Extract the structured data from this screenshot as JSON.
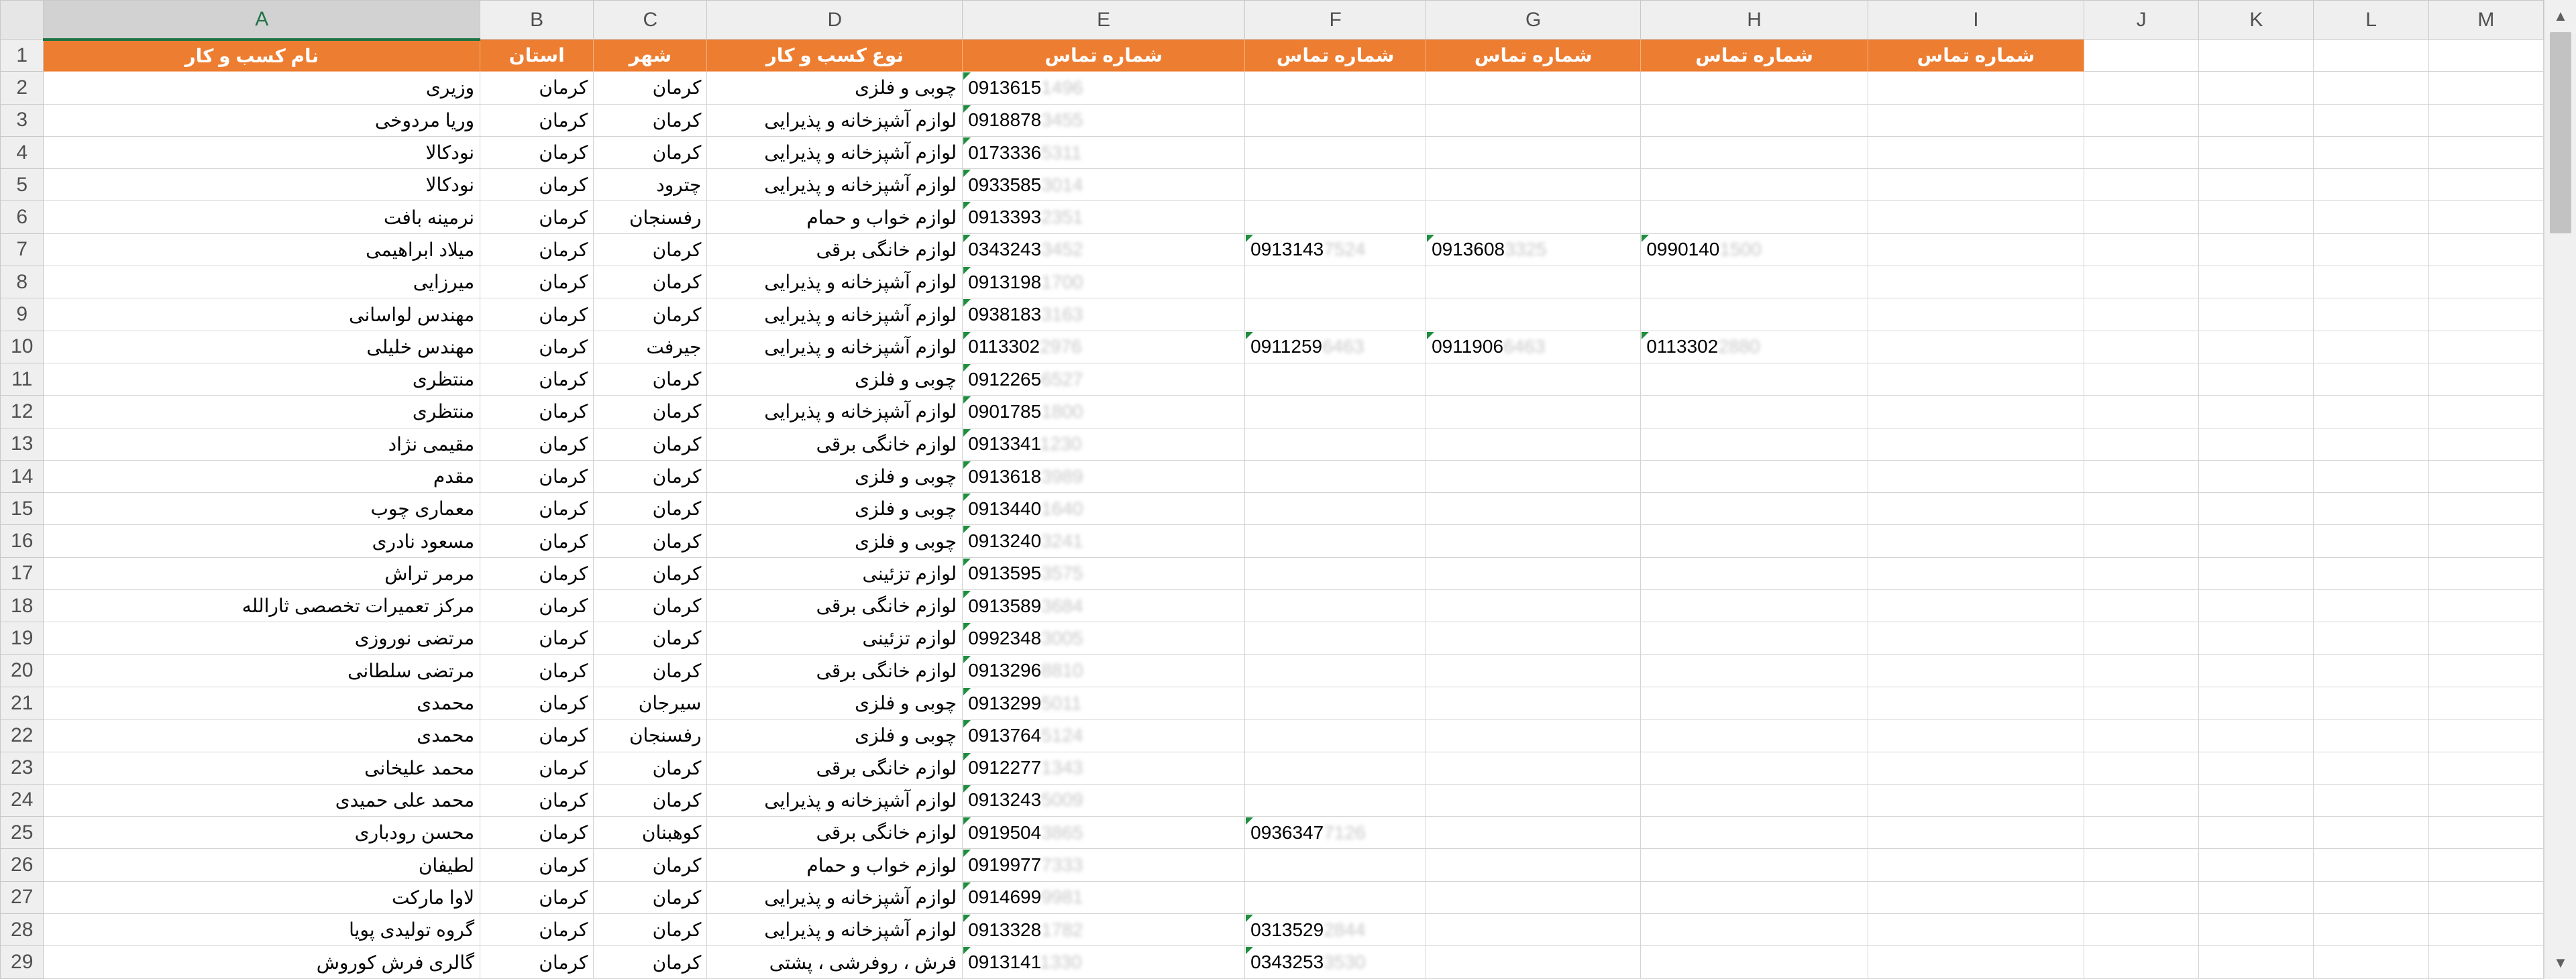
{
  "columns": [
    "A",
    "B",
    "C",
    "D",
    "E",
    "F",
    "G",
    "H",
    "I",
    "J",
    "K",
    "L",
    "M"
  ],
  "active_column": "A",
  "header_row": {
    "number": "1",
    "name": "نام کسب و کار",
    "province": "استان",
    "city": "شهر",
    "type": "نوع کسب و کار",
    "phone": "شماره تماس",
    "phone2": "شماره تماس",
    "phone3": "شماره تماس",
    "phone4": "شماره تماس",
    "phone5": "شماره تماس"
  },
  "rows": [
    {
      "n": "2",
      "name": "وزیری",
      "prov": "کرمان",
      "city": "کرمان",
      "type": "چوبی و فلزی",
      "ph": "0913615",
      "phb": "1496",
      "x1": "",
      "x1b": "",
      "x2": "",
      "x2b": "",
      "x3": "",
      "x3b": ""
    },
    {
      "n": "3",
      "name": "وریا مردوخی",
      "prov": "کرمان",
      "city": "کرمان",
      "type": "لوازم آشپزخانه و پذیرایی",
      "ph": "0918878",
      "phb": "3455",
      "x1": "",
      "x1b": "",
      "x2": "",
      "x2b": "",
      "x3": "",
      "x3b": ""
    },
    {
      "n": "4",
      "name": "نودکالا",
      "prov": "کرمان",
      "city": "کرمان",
      "type": "لوازم آشپزخانه و پذیرایی",
      "ph": "0173336",
      "phb": "5311",
      "x1": "",
      "x1b": "",
      "x2": "",
      "x2b": "",
      "x3": "",
      "x3b": ""
    },
    {
      "n": "5",
      "name": "نودکالا",
      "prov": "کرمان",
      "city": "چترود",
      "type": "لوازم آشپزخانه و پذیرایی",
      "ph": "0933585",
      "phb": "3014",
      "x1": "",
      "x1b": "",
      "x2": "",
      "x2b": "",
      "x3": "",
      "x3b": ""
    },
    {
      "n": "6",
      "name": "نرمینه بافت",
      "prov": "کرمان",
      "city": "رفسنجان",
      "type": "لوازم خواب و حمام",
      "ph": "0913393",
      "phb": "2351",
      "x1": "",
      "x1b": "",
      "x2": "",
      "x2b": "",
      "x3": "",
      "x3b": ""
    },
    {
      "n": "7",
      "name": "میلاد ابراهیمی",
      "prov": "کرمان",
      "city": "کرمان",
      "type": "لوازم خانگی برقی",
      "ph": "0343243",
      "phb": "3452",
      "x1": "0913143",
      "x1b": "7524",
      "x2": "0913608",
      "x2b": "3325",
      "x3": "0990140",
      "x3b": "1500"
    },
    {
      "n": "8",
      "name": "میرزایی",
      "prov": "کرمان",
      "city": "کرمان",
      "type": "لوازم آشپزخانه و پذیرایی",
      "ph": "0913198",
      "phb": "1700",
      "x1": "",
      "x1b": "",
      "x2": "",
      "x2b": "",
      "x3": "",
      "x3b": ""
    },
    {
      "n": "9",
      "name": "مهندس لواسانی",
      "prov": "کرمان",
      "city": "کرمان",
      "type": "لوازم آشپزخانه و پذیرایی",
      "ph": "0938183",
      "phb": "3163",
      "x1": "",
      "x1b": "",
      "x2": "",
      "x2b": "",
      "x3": "",
      "x3b": ""
    },
    {
      "n": "10",
      "name": "مهندس خلیلی",
      "prov": "کرمان",
      "city": "جیرفت",
      "type": "لوازم آشپزخانه و پذیرایی",
      "ph": "0113302",
      "phb": "2976",
      "x1": "0911259",
      "x1b": "6463",
      "x2": "0911906",
      "x2b": "6463",
      "x3": "0113302",
      "x3b": "2880"
    },
    {
      "n": "11",
      "name": "منتظری",
      "prov": "کرمان",
      "city": "کرمان",
      "type": "چوبی و فلزی",
      "ph": "0912265",
      "phb": "6527",
      "x1": "",
      "x1b": "",
      "x2": "",
      "x2b": "",
      "x3": "",
      "x3b": ""
    },
    {
      "n": "12",
      "name": "منتظری",
      "prov": "کرمان",
      "city": "کرمان",
      "type": "لوازم آشپزخانه و پذیرایی",
      "ph": "0901785",
      "phb": "1800",
      "x1": "",
      "x1b": "",
      "x2": "",
      "x2b": "",
      "x3": "",
      "x3b": ""
    },
    {
      "n": "13",
      "name": "مقیمی نژاد",
      "prov": "کرمان",
      "city": "کرمان",
      "type": "لوازم خانگی برقی",
      "ph": "0913341",
      "phb": "1230",
      "x1": "",
      "x1b": "",
      "x2": "",
      "x2b": "",
      "x3": "",
      "x3b": ""
    },
    {
      "n": "14",
      "name": "مقدم",
      "prov": "کرمان",
      "city": "کرمان",
      "type": "چوبی و فلزی",
      "ph": "0913618",
      "phb": "3989",
      "x1": "",
      "x1b": "",
      "x2": "",
      "x2b": "",
      "x3": "",
      "x3b": ""
    },
    {
      "n": "15",
      "name": "معماری چوب",
      "prov": "کرمان",
      "city": "کرمان",
      "type": "چوبی و فلزی",
      "ph": "0913440",
      "phb": "1640",
      "x1": "",
      "x1b": "",
      "x2": "",
      "x2b": "",
      "x3": "",
      "x3b": ""
    },
    {
      "n": "16",
      "name": "مسعود نادری",
      "prov": "کرمان",
      "city": "کرمان",
      "type": "چوبی و فلزی",
      "ph": "0913240",
      "phb": "3241",
      "x1": "",
      "x1b": "",
      "x2": "",
      "x2b": "",
      "x3": "",
      "x3b": ""
    },
    {
      "n": "17",
      "name": "مرمر تراش",
      "prov": "کرمان",
      "city": "کرمان",
      "type": "لوازم تزئینی",
      "ph": "0913595",
      "phb": "3575",
      "x1": "",
      "x1b": "",
      "x2": "",
      "x2b": "",
      "x3": "",
      "x3b": ""
    },
    {
      "n": "18",
      "name": "مرکز تعمیرات تخصصی ثارالله",
      "prov": "کرمان",
      "city": "کرمان",
      "type": "لوازم خانگی برقی",
      "ph": "0913589",
      "phb": "3684",
      "x1": "",
      "x1b": "",
      "x2": "",
      "x2b": "",
      "x3": "",
      "x3b": ""
    },
    {
      "n": "19",
      "name": "مرتضی نوروزی",
      "prov": "کرمان",
      "city": "کرمان",
      "type": "لوازم تزئینی",
      "ph": "0992348",
      "phb": "3005",
      "x1": "",
      "x1b": "",
      "x2": "",
      "x2b": "",
      "x3": "",
      "x3b": ""
    },
    {
      "n": "20",
      "name": "مرتضی سلطانی",
      "prov": "کرمان",
      "city": "کرمان",
      "type": "لوازم خانگی برقی",
      "ph": "0913296",
      "phb": "8810",
      "x1": "",
      "x1b": "",
      "x2": "",
      "x2b": "",
      "x3": "",
      "x3b": ""
    },
    {
      "n": "21",
      "name": "محمدی",
      "prov": "کرمان",
      "city": "سیرجان",
      "type": "چوبی و فلزی",
      "ph": "0913299",
      "phb": "5011",
      "x1": "",
      "x1b": "",
      "x2": "",
      "x2b": "",
      "x3": "",
      "x3b": ""
    },
    {
      "n": "22",
      "name": "محمدی",
      "prov": "کرمان",
      "city": "رفسنجان",
      "type": "چوبی و فلزی",
      "ph": "0913764",
      "phb": "5124",
      "x1": "",
      "x1b": "",
      "x2": "",
      "x2b": "",
      "x3": "",
      "x3b": ""
    },
    {
      "n": "23",
      "name": "محمد علیخانی",
      "prov": "کرمان",
      "city": "کرمان",
      "type": "لوازم خانگی برقی",
      "ph": "0912277",
      "phb": "1343",
      "x1": "",
      "x1b": "",
      "x2": "",
      "x2b": "",
      "x3": "",
      "x3b": ""
    },
    {
      "n": "24",
      "name": "محمد علی حمیدی",
      "prov": "کرمان",
      "city": "کرمان",
      "type": "لوازم آشپزخانه و پذیرایی",
      "ph": "0913243",
      "phb": "5009",
      "x1": "",
      "x1b": "",
      "x2": "",
      "x2b": "",
      "x3": "",
      "x3b": ""
    },
    {
      "n": "25",
      "name": "محسن رودباری",
      "prov": "کرمان",
      "city": "کوهبنان",
      "type": "لوازم خانگی برقی",
      "ph": "0919504",
      "phb": "3865",
      "x1": "0936347",
      "x1b": "7126",
      "x2": "",
      "x2b": "",
      "x3": "",
      "x3b": ""
    },
    {
      "n": "26",
      "name": "لطیفان",
      "prov": "کرمان",
      "city": "کرمان",
      "type": "لوازم خواب و حمام",
      "ph": "0919977",
      "phb": "7333",
      "x1": "",
      "x1b": "",
      "x2": "",
      "x2b": "",
      "x3": "",
      "x3b": ""
    },
    {
      "n": "27",
      "name": "لاوا مارکت",
      "prov": "کرمان",
      "city": "کرمان",
      "type": "لوازم آشپزخانه و پذیرایی",
      "ph": "0914699",
      "phb": "9981",
      "x1": "",
      "x1b": "",
      "x2": "",
      "x2b": "",
      "x3": "",
      "x3b": ""
    },
    {
      "n": "28",
      "name": "گروه تولیدی پویا",
      "prov": "کرمان",
      "city": "کرمان",
      "type": "لوازم آشپزخانه و پذیرایی",
      "ph": "0913328",
      "phb": "1782",
      "x1": "0313529",
      "x1b": "2844",
      "x2": "",
      "x2b": "",
      "x3": "",
      "x3b": ""
    },
    {
      "n": "29",
      "name": "گالری فرش کوروش",
      "prov": "کرمان",
      "city": "کرمان",
      "type": "فرش ، روفرشی ، پشتی",
      "ph": "0913141",
      "phb": "1330",
      "x1": "0343253",
      "x1b": "3530",
      "x2": "",
      "x2b": "",
      "x3": "",
      "x3b": ""
    }
  ]
}
